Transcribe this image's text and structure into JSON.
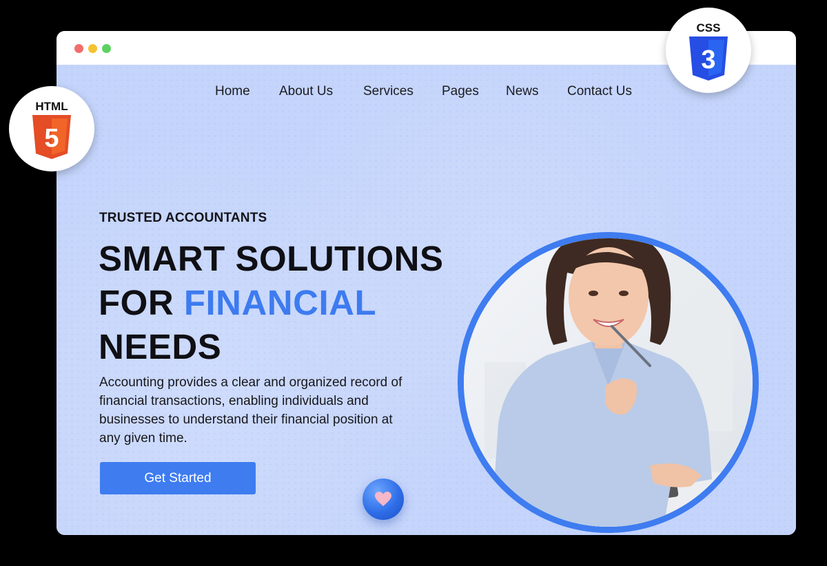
{
  "nav": {
    "items": [
      "Home",
      "About Us",
      "Services",
      "Pages",
      "News",
      "Contact Us"
    ]
  },
  "hero": {
    "eyebrow": "TRUSTED ACCOUNTANTS",
    "headline_line1": "SMART SOLUTIONS",
    "headline_for": "FOR ",
    "headline_accent": "FINANCIAL",
    "headline_line3": "NEEDS",
    "description": "Accounting provides a clear and organized record of financial transactions, enabling individuals and businesses to understand their financial position at any given time.",
    "cta_label": "Get Started"
  },
  "badges": {
    "html": "HTML",
    "html_digit": "5",
    "css": "CSS",
    "css_digit": "3"
  },
  "colors": {
    "accent": "#3e7cf0",
    "background": "#c4d4fb",
    "html_orange": "#e44d26",
    "css_blue": "#264de4"
  },
  "icons": [
    "heart-icon",
    "html5-shield-icon",
    "css3-shield-icon"
  ]
}
